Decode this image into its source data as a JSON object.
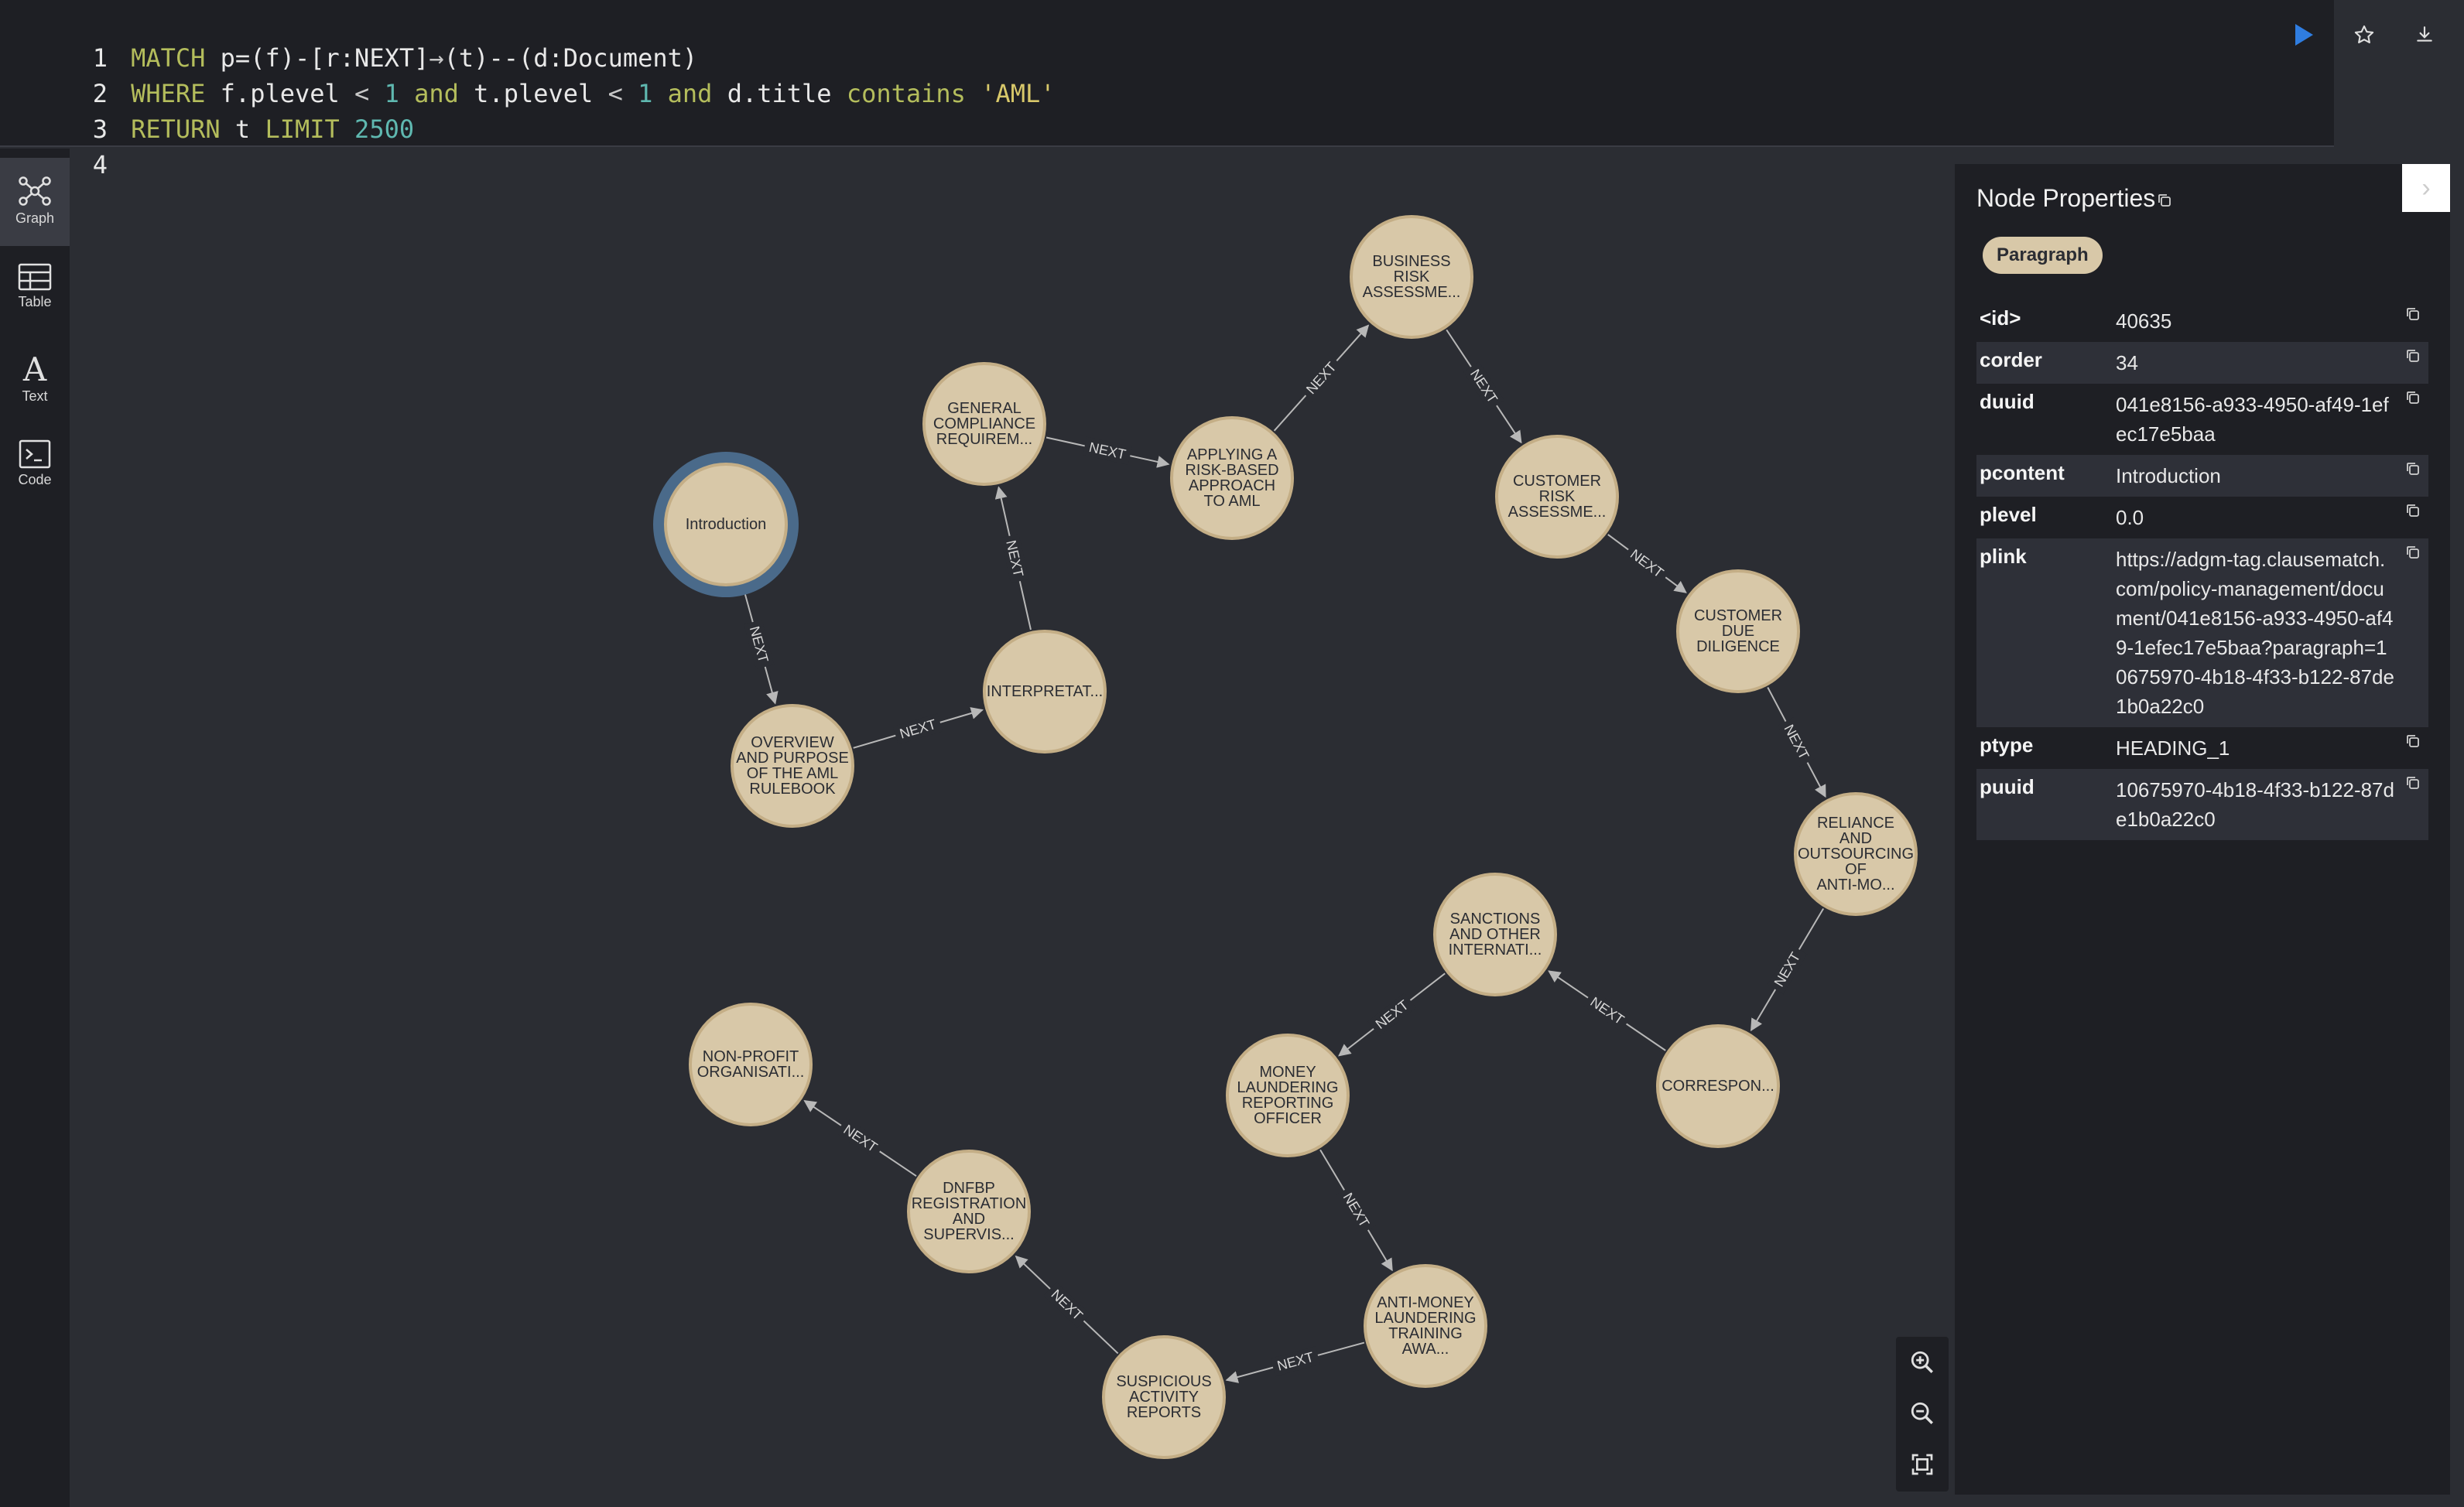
{
  "editor": {
    "lines": [
      {
        "n": "1"
      },
      {
        "n": "2"
      },
      {
        "n": "3"
      },
      {
        "n": "4"
      }
    ],
    "l1": {
      "kw": "MATCH",
      "a": " p=(f)-[r:NEXT]",
      "arrow": "→",
      "b": "(t)--(d:Document)"
    },
    "l2": {
      "kw": "WHERE",
      "a": " f.plevel ",
      "lt1": "<",
      "n1": " 1",
      "and1": " and",
      "b": " t.plevel ",
      "lt2": "<",
      "n2": " 1",
      "and2": " and",
      "c": " d.title ",
      "contains": "contains",
      "str": " 'AML'"
    },
    "l3": {
      "kw": "RETURN",
      "a": " t ",
      "limit": "LIMIT",
      "n": " 2500"
    }
  },
  "sidebar": [
    {
      "label": "Graph",
      "icon": "graph-icon"
    },
    {
      "label": "Table",
      "icon": "table-icon"
    },
    {
      "label": "Text",
      "icon": "text-icon"
    },
    {
      "label": "Code",
      "icon": "code-icon"
    }
  ],
  "edge_label": "NEXT",
  "nodes": [
    {
      "id": "introduction",
      "lines": [
        "Introduction"
      ]
    },
    {
      "id": "overview",
      "lines": [
        "OVERVIEW",
        "AND PURPOSE",
        "OF THE AML",
        "RULEBOOK"
      ]
    },
    {
      "id": "interpretat",
      "lines": [
        "INTERPRETAT..."
      ]
    },
    {
      "id": "general",
      "lines": [
        "GENERAL",
        "COMPLIANCE",
        "REQUIREM..."
      ]
    },
    {
      "id": "applying",
      "lines": [
        "APPLYING A",
        "RISK-BASED",
        "APPROACH",
        "TO AML"
      ]
    },
    {
      "id": "business",
      "lines": [
        "BUSINESS",
        "RISK",
        "ASSESSME..."
      ]
    },
    {
      "id": "customer-risk",
      "lines": [
        "CUSTOMER",
        "RISK",
        "ASSESSME..."
      ]
    },
    {
      "id": "cdd",
      "lines": [
        "CUSTOMER",
        "DUE",
        "DILIGENCE"
      ]
    },
    {
      "id": "reliance",
      "lines": [
        "RELIANCE",
        "AND",
        "OUTSOURCING",
        "OF",
        "ANTI-MO..."
      ]
    },
    {
      "id": "correspon",
      "lines": [
        "CORRESPON..."
      ]
    },
    {
      "id": "sanctions",
      "lines": [
        "SANCTIONS",
        "AND OTHER",
        "INTERNATI..."
      ]
    },
    {
      "id": "mlro",
      "lines": [
        "MONEY",
        "LAUNDERING",
        "REPORTING",
        "OFFICER"
      ]
    },
    {
      "id": "aml-training",
      "lines": [
        "ANTI-MONEY",
        "LAUNDERING",
        "TRAINING",
        "AWA..."
      ]
    },
    {
      "id": "sar",
      "lines": [
        "SUSPICIOUS",
        "ACTIVITY",
        "REPORTS"
      ]
    },
    {
      "id": "dnfbp",
      "lines": [
        "DNFBP",
        "REGISTRATION",
        "AND",
        "SUPERVIS..."
      ]
    },
    {
      "id": "npo",
      "lines": [
        "NON-PROFIT",
        "ORGANISATI..."
      ]
    }
  ],
  "panel": {
    "title": "Node Properties",
    "badge": "Paragraph",
    "props": [
      {
        "k": "<id>",
        "v": "40635"
      },
      {
        "k": "corder",
        "v": "34"
      },
      {
        "k": "duuid",
        "v": "041e8156-a933-4950-af49-1efec17e5baa"
      },
      {
        "k": "pcontent",
        "v": "Introduction"
      },
      {
        "k": "plevel",
        "v": "0.0"
      },
      {
        "k": "plink",
        "v": "https://adgm-tag.clausematch.com/policy-management/document/041e8156-a933-4950-af49-1efec17e5baa?paragraph=10675970-4b18-4f33-b122-87de1b0a22c0"
      },
      {
        "k": "ptype",
        "v": "HEADING_1"
      },
      {
        "k": "puuid",
        "v": "10675970-4b18-4f33-b122-87de1b0a22c0"
      }
    ]
  },
  "colors": {
    "node_fill": "#d8c8a8",
    "node_stroke": "#c4ae86",
    "selected_ring": "#4a6a8a",
    "edge": "#b8b8b8",
    "accent": "#2f7de1"
  }
}
